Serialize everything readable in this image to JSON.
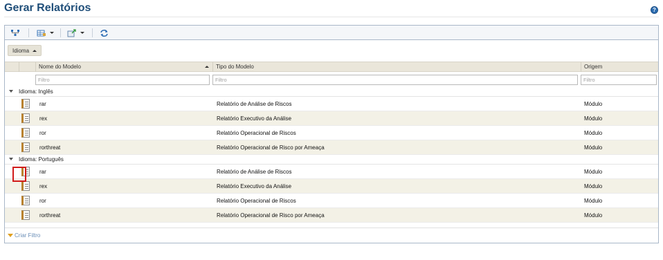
{
  "page": {
    "title": "Gerar Relatórios",
    "help_label": "?"
  },
  "colors": {
    "title": "#1f4e79",
    "row_alt": "#f3f1e6",
    "header_bg": "#eae6da",
    "highlight": "#d11a1a",
    "link": "#6c8fb8"
  },
  "toolbar": {
    "icons": [
      "hierarchy-icon",
      "grid-view-icon",
      "export-icon",
      "refresh-icon"
    ]
  },
  "grouping": {
    "chip_label": "Idioma"
  },
  "grid": {
    "columns": [
      {
        "label": "Nome do Modelo"
      },
      {
        "label": "Tipo do Modelo"
      },
      {
        "label": "Origem"
      }
    ],
    "filter_placeholder": "Filtro",
    "groups": [
      {
        "label": "Idioma: Inglês",
        "rows": [
          {
            "name": "rar",
            "type": "Relatório de Análise de Riscos",
            "origin": "Módulo"
          },
          {
            "name": "rex",
            "type": "Relatório Executivo da Análise",
            "origin": "Módulo"
          },
          {
            "name": "ror",
            "type": "Relatório Operacional de Riscos",
            "origin": "Módulo"
          },
          {
            "name": "rorthreat",
            "type": "Relatório Operacional de Risco por Ameaça",
            "origin": "Módulo"
          }
        ]
      },
      {
        "label": "Idioma: Português",
        "rows": [
          {
            "name": "rar",
            "type": "Relatório de Análise de Riscos",
            "origin": "Módulo"
          },
          {
            "name": "rex",
            "type": "Relatório Executivo da Análise",
            "origin": "Módulo"
          },
          {
            "name": "ror",
            "type": "Relatório Operacional de Riscos",
            "origin": "Módulo"
          },
          {
            "name": "rorthreat",
            "type": "Relatório Operacional de Risco por Ameaça",
            "origin": "Módulo"
          }
        ]
      }
    ]
  },
  "footer": {
    "create_filter_label": "Criar Filtro"
  }
}
